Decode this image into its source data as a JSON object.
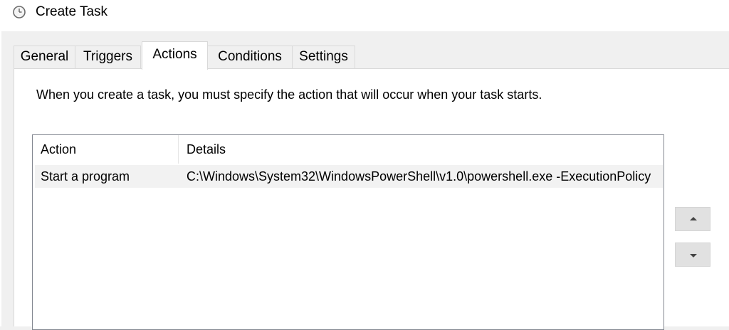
{
  "window": {
    "title": "Create Task",
    "icon": "clock-icon"
  },
  "tabs": [
    {
      "label": "General",
      "active": false
    },
    {
      "label": "Triggers",
      "active": false
    },
    {
      "label": "Actions",
      "active": true
    },
    {
      "label": "Conditions",
      "active": false
    },
    {
      "label": "Settings",
      "active": false
    }
  ],
  "actions_tab": {
    "instruction": "When you create a task, you must specify the action that will occur when your task starts.",
    "list": {
      "columns": [
        "Action",
        "Details"
      ],
      "rows": [
        {
          "action": "Start a program",
          "details": "C:\\Windows\\System32\\WindowsPowerShell\\v1.0\\powershell.exe -ExecutionPolicy"
        }
      ]
    },
    "side_buttons": [
      {
        "icon": "move-up-arrow-icon"
      },
      {
        "icon": "move-down-arrow-icon"
      }
    ]
  }
}
